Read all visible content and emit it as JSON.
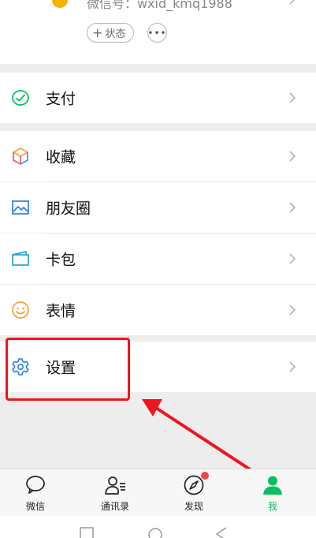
{
  "profile": {
    "wechat_id": "微信号：wxid_kmq1988",
    "status_label": "状态",
    "more_label": "•••"
  },
  "menu": {
    "pay": "支付",
    "favorites": "收藏",
    "moments": "朋友圈",
    "cards": "卡包",
    "stickers": "表情",
    "settings": "设置"
  },
  "tabs": {
    "chats": "微信",
    "contacts": "通讯录",
    "discover": "发现",
    "me": "我"
  },
  "colors": {
    "accent": "#07c160",
    "highlight": "#f0141e",
    "badge": "#f04848"
  }
}
